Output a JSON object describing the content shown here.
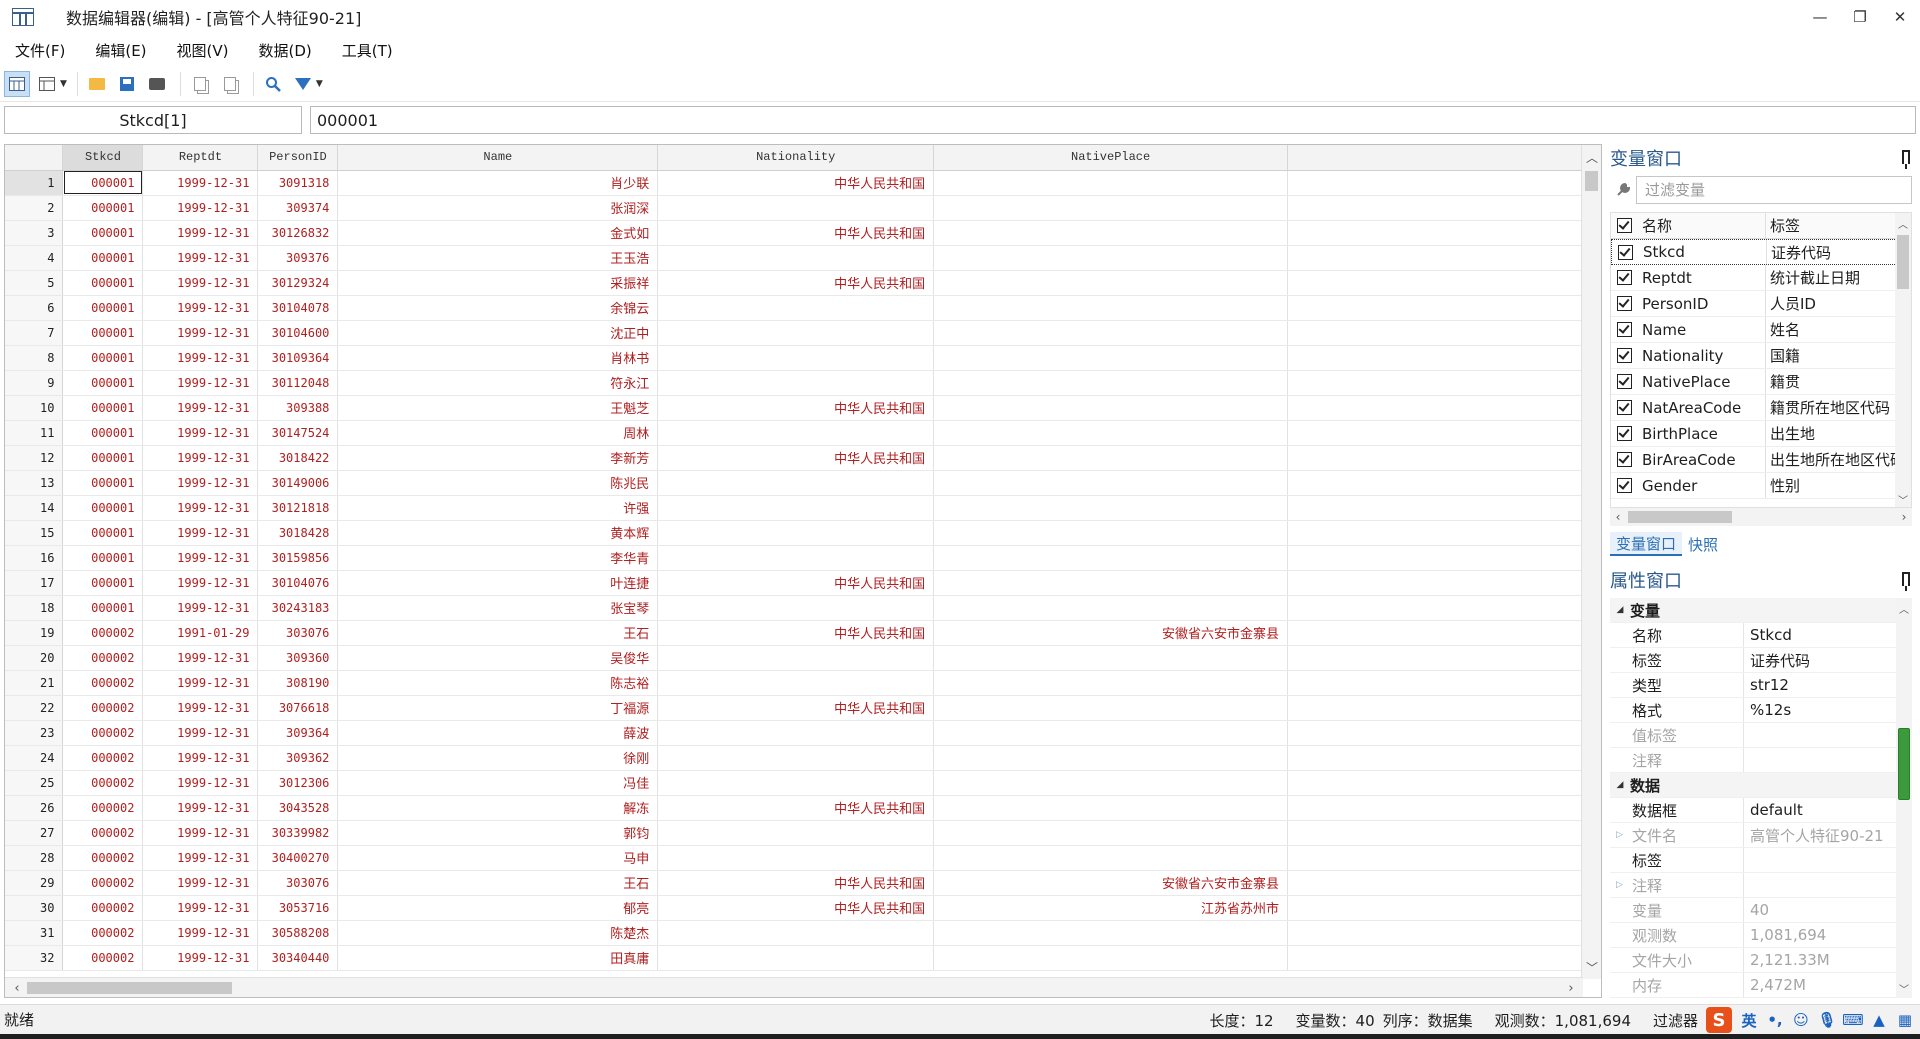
{
  "window": {
    "title": "数据编辑器(编辑) - [高管个人特征90-21]",
    "minimize": "—",
    "restore": "❐",
    "close": "✕"
  },
  "menu": [
    {
      "label": "文件(F)"
    },
    {
      "label": "编辑(E)"
    },
    {
      "label": "视图(V)"
    },
    {
      "label": "数据(D)"
    },
    {
      "label": "工具(T)"
    }
  ],
  "toolbar": {
    "icons": [
      "data-editor-edit-icon",
      "data-editor-browse-icon",
      "open-icon",
      "save-icon",
      "print-icon",
      "copy-icon",
      "paste-icon",
      "find-icon",
      "filter-icon"
    ]
  },
  "cell_bar": {
    "variable_ref": "Stkcd[1]",
    "value": "000001"
  },
  "grid": {
    "columns": [
      "Stkcd",
      "Reptdt",
      "PersonID",
      "Name",
      "Nationality",
      "NativePlace"
    ],
    "rows": [
      [
        "1",
        "000001",
        "1999-12-31",
        "3091318",
        "肖少联",
        "中华人民共和国",
        ""
      ],
      [
        "2",
        "000001",
        "1999-12-31",
        "309374",
        "张润深",
        "",
        ""
      ],
      [
        "3",
        "000001",
        "1999-12-31",
        "30126832",
        "金式如",
        "中华人民共和国",
        ""
      ],
      [
        "4",
        "000001",
        "1999-12-31",
        "309376",
        "王玉浩",
        "",
        ""
      ],
      [
        "5",
        "000001",
        "1999-12-31",
        "30129324",
        "采振祥",
        "中华人民共和国",
        ""
      ],
      [
        "6",
        "000001",
        "1999-12-31",
        "30104078",
        "余锦云",
        "",
        ""
      ],
      [
        "7",
        "000001",
        "1999-12-31",
        "30104600",
        "沈正中",
        "",
        ""
      ],
      [
        "8",
        "000001",
        "1999-12-31",
        "30109364",
        "肖林书",
        "",
        ""
      ],
      [
        "9",
        "000001",
        "1999-12-31",
        "30112048",
        "符永江",
        "",
        ""
      ],
      [
        "10",
        "000001",
        "1999-12-31",
        "309388",
        "王魁芝",
        "中华人民共和国",
        ""
      ],
      [
        "11",
        "000001",
        "1999-12-31",
        "30147524",
        "周林",
        "",
        ""
      ],
      [
        "12",
        "000001",
        "1999-12-31",
        "3018422",
        "李新芳",
        "中华人民共和国",
        ""
      ],
      [
        "13",
        "000001",
        "1999-12-31",
        "30149006",
        "陈兆民",
        "",
        ""
      ],
      [
        "14",
        "000001",
        "1999-12-31",
        "30121818",
        "许强",
        "",
        ""
      ],
      [
        "15",
        "000001",
        "1999-12-31",
        "3018428",
        "黄本辉",
        "",
        ""
      ],
      [
        "16",
        "000001",
        "1999-12-31",
        "30159856",
        "李华青",
        "",
        ""
      ],
      [
        "17",
        "000001",
        "1999-12-31",
        "30104076",
        "叶连捷",
        "中华人民共和国",
        ""
      ],
      [
        "18",
        "000001",
        "1999-12-31",
        "30243183",
        "张宝琴",
        "",
        ""
      ],
      [
        "19",
        "000002",
        "1991-01-29",
        "303076",
        "王石",
        "中华人民共和国",
        "安徽省六安市金寨县"
      ],
      [
        "20",
        "000002",
        "1999-12-31",
        "309360",
        "吴俊华",
        "",
        ""
      ],
      [
        "21",
        "000002",
        "1999-12-31",
        "308190",
        "陈志裕",
        "",
        ""
      ],
      [
        "22",
        "000002",
        "1999-12-31",
        "3076618",
        "丁福源",
        "中华人民共和国",
        ""
      ],
      [
        "23",
        "000002",
        "1999-12-31",
        "309364",
        "薛波",
        "",
        ""
      ],
      [
        "24",
        "000002",
        "1999-12-31",
        "309362",
        "徐刚",
        "",
        ""
      ],
      [
        "25",
        "000002",
        "1999-12-31",
        "3012306",
        "冯佳",
        "",
        ""
      ],
      [
        "26",
        "000002",
        "1999-12-31",
        "3043528",
        "解冻",
        "中华人民共和国",
        ""
      ],
      [
        "27",
        "000002",
        "1999-12-31",
        "30339982",
        "郭钧",
        "",
        ""
      ],
      [
        "28",
        "000002",
        "1999-12-31",
        "30400270",
        "马申",
        "",
        ""
      ],
      [
        "29",
        "000002",
        "1999-12-31",
        "303076",
        "王石",
        "中华人民共和国",
        "安徽省六安市金寨县"
      ],
      [
        "30",
        "000002",
        "1999-12-31",
        "3053716",
        "郁亮",
        "中华人民共和国",
        "江苏省苏州市"
      ],
      [
        "31",
        "000002",
        "1999-12-31",
        "30588208",
        "陈楚杰",
        "",
        ""
      ],
      [
        "32",
        "000002",
        "1999-12-31",
        "30340440",
        "田真庸",
        "",
        ""
      ]
    ]
  },
  "variables_pane": {
    "title": "变量窗口",
    "filter_placeholder": "过滤变量",
    "header_name": "名称",
    "header_label": "标签",
    "items": [
      {
        "name": "Stkcd",
        "label": "证券代码"
      },
      {
        "name": "Reptdt",
        "label": "统计截止日期"
      },
      {
        "name": "PersonID",
        "label": "人员ID"
      },
      {
        "name": "Name",
        "label": "姓名"
      },
      {
        "name": "Nationality",
        "label": "国籍"
      },
      {
        "name": "NativePlace",
        "label": "籍贯"
      },
      {
        "name": "NatAreaCode",
        "label": "籍贯所在地区代码"
      },
      {
        "name": "BirthPlace",
        "label": "出生地"
      },
      {
        "name": "BirAreaCode",
        "label": "出生地所在地区代码"
      },
      {
        "name": "Gender",
        "label": "性别"
      }
    ],
    "tabs": [
      "变量窗口",
      "快照"
    ]
  },
  "properties_pane": {
    "title": "属性窗口",
    "groups": [
      {
        "name": "变量",
        "rows": [
          {
            "k": "名称",
            "v": "Stkcd",
            "dim": false
          },
          {
            "k": "标签",
            "v": "证券代码",
            "dim": false
          },
          {
            "k": "类型",
            "v": "str12",
            "dim": false
          },
          {
            "k": "格式",
            "v": "%12s",
            "dim": false
          },
          {
            "k": "值标签",
            "v": "",
            "dim": true
          },
          {
            "k": "注释",
            "v": "",
            "dim": true
          }
        ]
      },
      {
        "name": "数据",
        "rows": [
          {
            "k": "数据框",
            "v": "default",
            "dim": false
          },
          {
            "k": "文件名",
            "v": "高管个人特征90-21",
            "dim": true
          },
          {
            "k": "标签",
            "v": "",
            "dim": false
          },
          {
            "k": "注释",
            "v": "",
            "dim": true
          },
          {
            "k": "变量",
            "v": "40",
            "dim": true
          },
          {
            "k": "观测数",
            "v": "1,081,694",
            "dim": true
          },
          {
            "k": "文件大小",
            "v": "2,121.33M",
            "dim": true
          },
          {
            "k": "内存",
            "v": "2,472M",
            "dim": true
          }
        ]
      }
    ]
  },
  "status": {
    "ready": "就绪",
    "length": "长度：12",
    "vars": "变量数：40",
    "order": "列序：数据集",
    "obs": "观测数：1,081,694",
    "filter": "过滤器",
    "ime_lang": "英"
  }
}
